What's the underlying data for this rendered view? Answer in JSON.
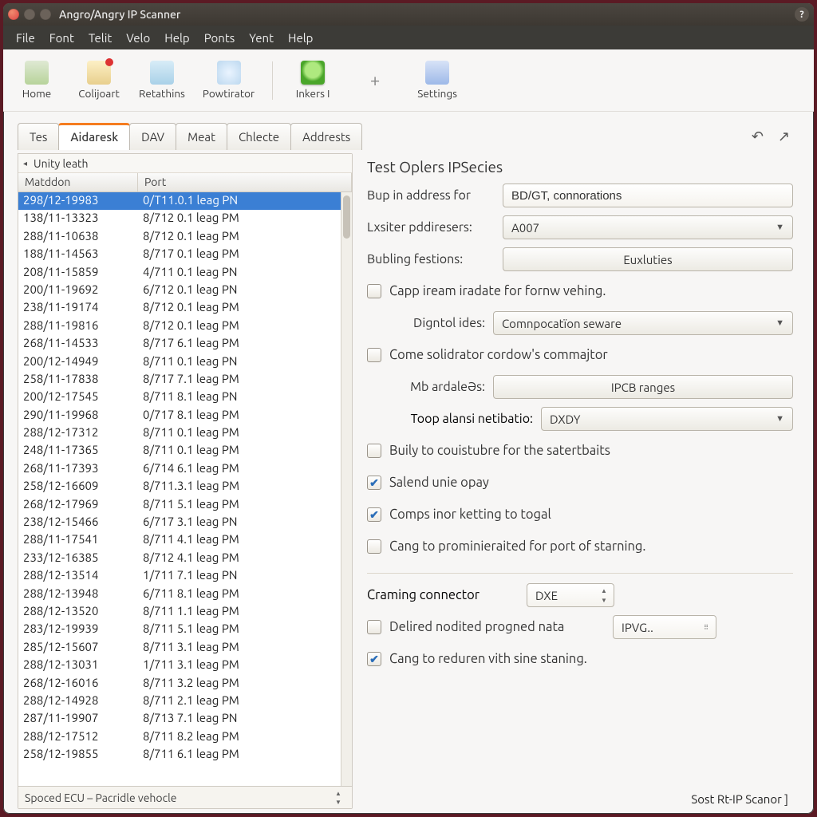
{
  "window": {
    "title": "Angro/Angry IP Scanner"
  },
  "menus": [
    "File",
    "Font",
    "Telit",
    "Velo",
    "Help",
    "Ponts",
    "Yent",
    "Help"
  ],
  "toolbar": [
    {
      "key": "home",
      "label": "Home"
    },
    {
      "key": "colijoart",
      "label": "Colijoart"
    },
    {
      "key": "retathins",
      "label": "Retathins"
    },
    {
      "key": "powtirator",
      "label": "Powtirator"
    },
    {
      "key": "inkers",
      "label": "Inkers I"
    },
    {
      "key": "settings",
      "label": "Settings"
    }
  ],
  "tabs": [
    "Tes",
    "Aidaresk",
    "DAV",
    "Meat",
    "Chlecte",
    "Addrests"
  ],
  "active_tab_index": 1,
  "left": {
    "path": "Unity leath",
    "columns": [
      "Matddon",
      "Port"
    ],
    "rows": [
      {
        "c1": "298/12-19983",
        "c2": "0/T11.0.1 leag PN"
      },
      {
        "c1": "138/11-13323",
        "c2": "8/712 0.1 leag PM"
      },
      {
        "c1": "288/11-10638",
        "c2": "8/712 0.1 leag PM"
      },
      {
        "c1": "188/11-14563",
        "c2": "8/717 0.1 leag PM"
      },
      {
        "c1": "208/11-15859",
        "c2": "4/711 0.1 leag PN"
      },
      {
        "c1": "200/11-19692",
        "c2": "6/712 0.1 leag PN"
      },
      {
        "c1": "238/11-19174",
        "c2": "8/712 0.1 leag PM"
      },
      {
        "c1": "288/11-19816",
        "c2": "8/712 0.1 leag PM"
      },
      {
        "c1": "268/11-14533",
        "c2": "8/717 6.1 leag PM"
      },
      {
        "c1": "200/12-14949",
        "c2": "8/711 0.1 leag PN"
      },
      {
        "c1": "258/11-17838",
        "c2": "8/717 7.1 leag PM"
      },
      {
        "c1": "200/12-17545",
        "c2": "8/711 8.1 leag PN"
      },
      {
        "c1": "290/11-19968",
        "c2": "0/717 8.1 leag PM"
      },
      {
        "c1": "288/12-17312",
        "c2": "8/711 0.1 leag PM"
      },
      {
        "c1": "248/11-17365",
        "c2": "8/711 0.1 leag PM"
      },
      {
        "c1": "268/11-17393",
        "c2": "6/714 6.1 leag PM"
      },
      {
        "c1": "258/12-16609",
        "c2": "8/711.3.1 leag PM"
      },
      {
        "c1": "268/12-17969",
        "c2": "8/711 5.1 leag PM"
      },
      {
        "c1": "238/12-15466",
        "c2": "6/717 3.1 leag PN"
      },
      {
        "c1": "288/11-17541",
        "c2": "8/711 4.1 leag PM"
      },
      {
        "c1": "233/12-16385",
        "c2": "8/712 4.1 leag PM"
      },
      {
        "c1": "288/12-13514",
        "c2": "1/711 7.1 leag PN"
      },
      {
        "c1": "288/12-13948",
        "c2": "6/711 8.1 leag PM"
      },
      {
        "c1": "288/12-13520",
        "c2": "8/711 1.1 leag PM"
      },
      {
        "c1": "283/12-19939",
        "c2": "8/711 5.1 leag PM"
      },
      {
        "c1": "285/12-15607",
        "c2": "8/711 3.1 leag PM"
      },
      {
        "c1": "288/12-13031",
        "c2": "1/711 3.1 leag PM"
      },
      {
        "c1": "268/12-16016",
        "c2": "8/711 3.2 leag PM"
      },
      {
        "c1": "288/12-14928",
        "c2": "8/711 2.1 leag PM"
      },
      {
        "c1": "287/11-19907",
        "c2": "8/713 7.1 leag PN"
      },
      {
        "c1": "288/12-17512",
        "c2": "8/711 8.2 leag PM"
      },
      {
        "c1": "258/12-19855",
        "c2": "8/711 6.1 leag PM"
      }
    ],
    "status": "Spoced ECU – Pacridle vehocle"
  },
  "right": {
    "title": "Test Oplers IPSecies",
    "addr_label": "Bup in address for",
    "addr_value": "BD/GT, connorations",
    "lxs_label": "Lxsiter pddiresers:",
    "lxs_value": "A007",
    "bubi_label": "Bubling festions:",
    "bubi_button": "Euxluties",
    "chk_capp": "Capp iream iradate for fornw vehing.",
    "dign_label": "Digntol ides:",
    "dign_value": "Comnpocatïon seware",
    "chk_come": "Come solidrator cordow's commajtor",
    "mb_label": "Mb ardaleəs:",
    "mb_button": "IPCB ranges",
    "toop_label": "Toop alansi netibatio:",
    "toop_value": "DXDY",
    "chk_buily": "Buily to couistubre for the satertbaits",
    "chk_salend": "Salend unie opay",
    "chk_comps": "Comps inor ketting to togal",
    "chk_cang1": "Cang to prominieraited for port of starning.",
    "cram_label": "Craming connector",
    "cram_value": "DXE",
    "chk_delired": "Delired nodited progned nata",
    "del_value": "IPVG..",
    "chk_cang2": "Cang to reduren vith sine staning."
  },
  "footer": "Sost Rt-IP Scanor ]"
}
